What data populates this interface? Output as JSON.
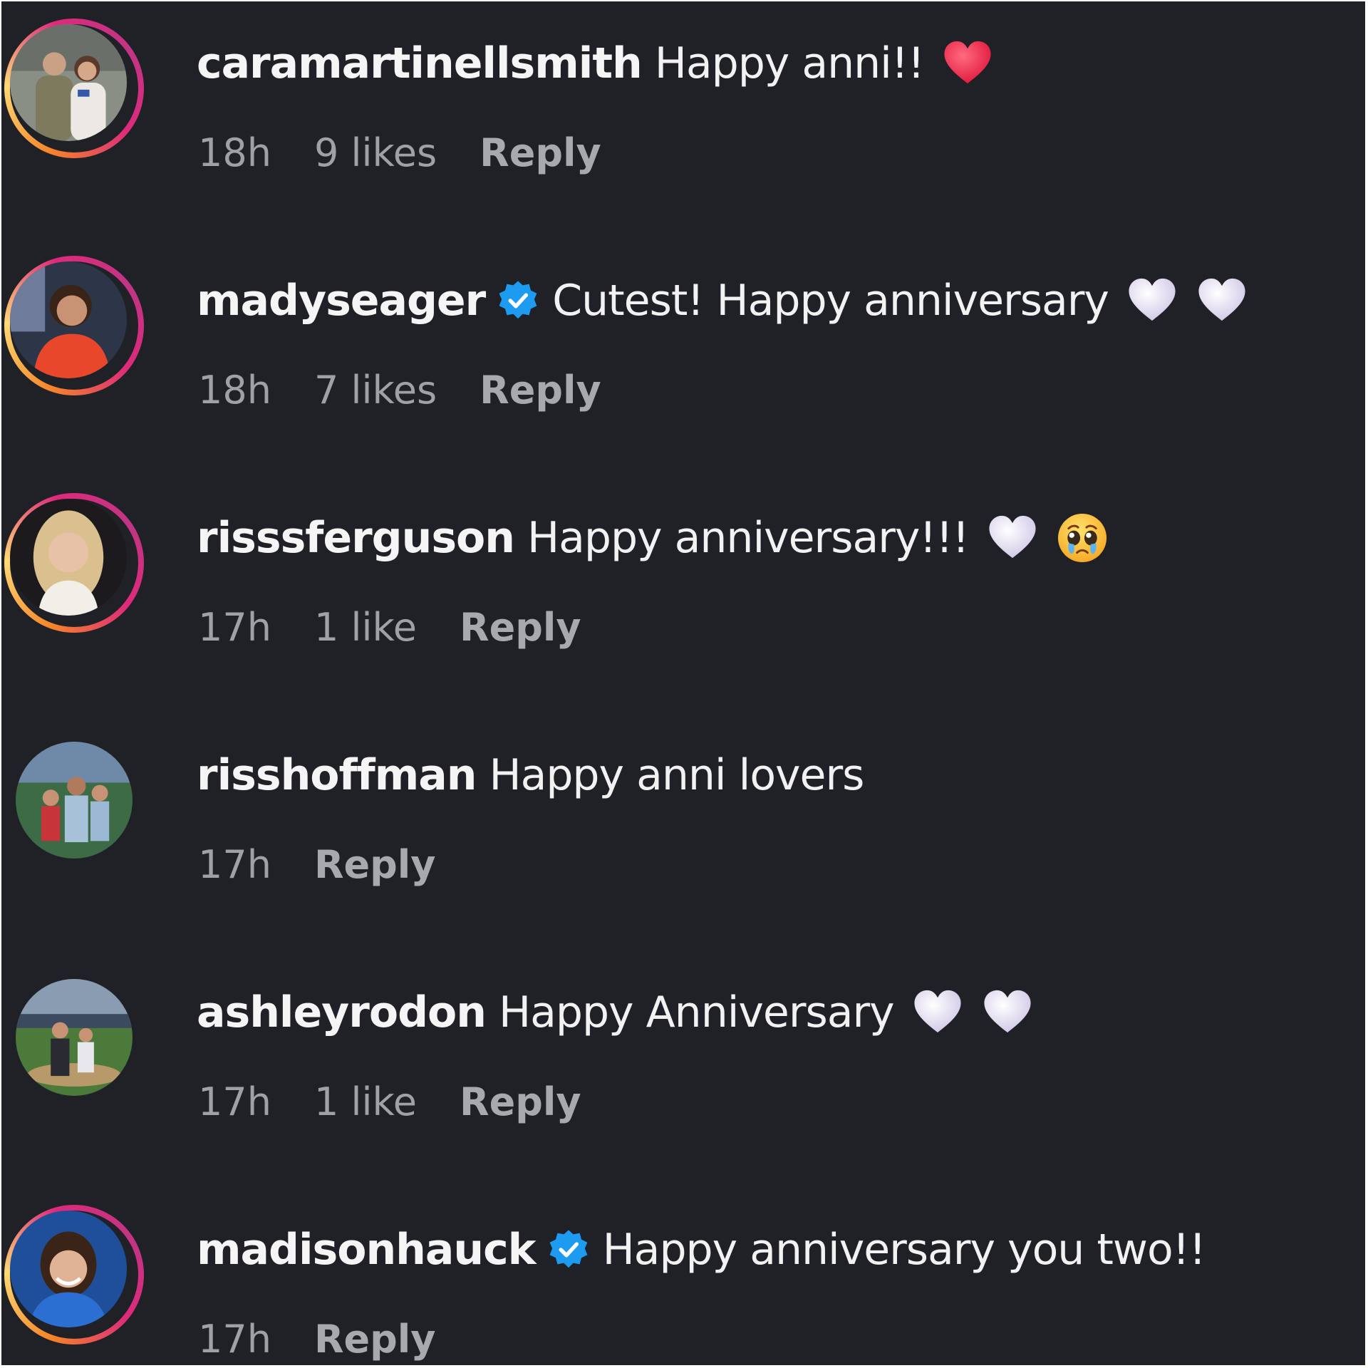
{
  "comments": [
    {
      "username": "caramartinellsmith",
      "verified": false,
      "text": "Happy anni!!",
      "emojis": [
        "red-heart"
      ],
      "time": "18h",
      "likes": "9 likes",
      "reply": "Reply"
    },
    {
      "username": "madyseager",
      "verified": true,
      "text": "Cutest! Happy anniversary",
      "emojis": [
        "white-heart",
        "white-heart"
      ],
      "time": "18h",
      "likes": "7 likes",
      "reply": "Reply"
    },
    {
      "username": "risssferguson",
      "verified": false,
      "text": "Happy anniversary!!!",
      "emojis": [
        "white-heart",
        "pleading-face"
      ],
      "time": "17h",
      "likes": "1 like",
      "reply": "Reply"
    },
    {
      "username": "risshoffman",
      "verified": false,
      "text": "Happy anni lovers",
      "emojis": [],
      "time": "17h",
      "likes": "",
      "reply": "Reply"
    },
    {
      "username": "ashleyrodon",
      "verified": false,
      "text": "Happy Anniversary",
      "emojis": [
        "white-heart",
        "white-heart"
      ],
      "time": "17h",
      "likes": "1 like",
      "reply": "Reply"
    },
    {
      "username": "madisonhauck",
      "verified": true,
      "text": "Happy anniversary you two!!",
      "emojis": [],
      "time": "17h",
      "likes": "",
      "reply": "Reply"
    }
  ],
  "colors": {
    "background": "#202127",
    "text": "#f2f2f2",
    "meta": "#a0a1a6",
    "verified": "#1d9bf0",
    "story_ring": [
      "#f58529",
      "#dd2a7b",
      "#c13584"
    ]
  }
}
